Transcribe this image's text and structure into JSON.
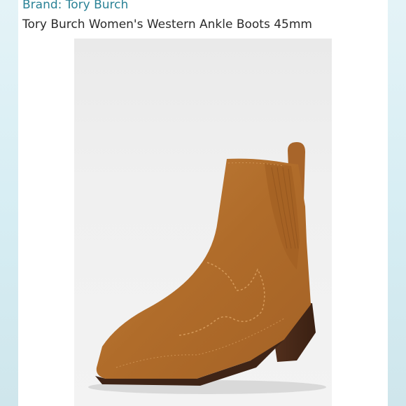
{
  "product": {
    "brand_label": "Brand: Tory Burch",
    "title": "Tory Burch Women's Western Ankle Boots 45mm"
  },
  "colors": {
    "brand_link": "#2a8296",
    "suede": "#b5732f",
    "heel": "#4a2a18",
    "side_accent": "#d6edf3"
  },
  "image": {
    "subject": "product-photo-boot"
  }
}
